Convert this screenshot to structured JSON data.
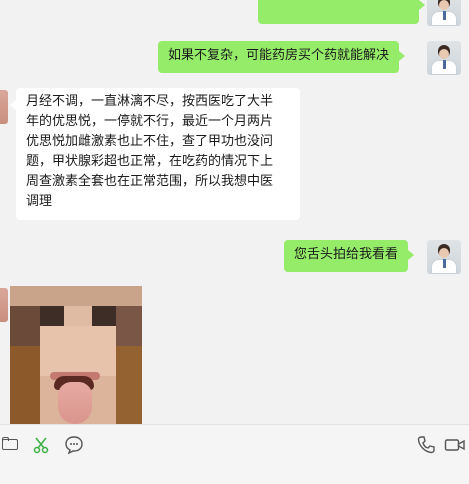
{
  "messages": [
    {
      "id": "m1",
      "direction": "out",
      "text": ""
    },
    {
      "id": "m2",
      "direction": "out",
      "text": "如果不复杂，可能药房买个药就能解决"
    },
    {
      "id": "m3",
      "direction": "in",
      "lines": [
        "月经不调，一直淋漓不尽，按西医吃了大半",
        "年的优思悦，一停就不行，最近一个月两片",
        "优思悦加雌激素也止不住，查了甲功也没问",
        "题，甲状腺彩超也正常，在吃药的情况下上",
        "周查激素全套也在正常范围，所以我想中医",
        "调理"
      ]
    },
    {
      "id": "m4",
      "direction": "out",
      "text": "您舌头拍给我看看"
    },
    {
      "id": "m5",
      "direction": "in",
      "type": "image"
    }
  ],
  "toolbar": {
    "icons": [
      "folder-icon",
      "scissors-icon",
      "emoji-icon",
      "phone-icon",
      "video-call-icon"
    ],
    "scissors_color": "#3cb043"
  },
  "colors": {
    "outgoing": "#95ec69",
    "incoming": "#ffffff",
    "background": "#f2f2f2"
  }
}
